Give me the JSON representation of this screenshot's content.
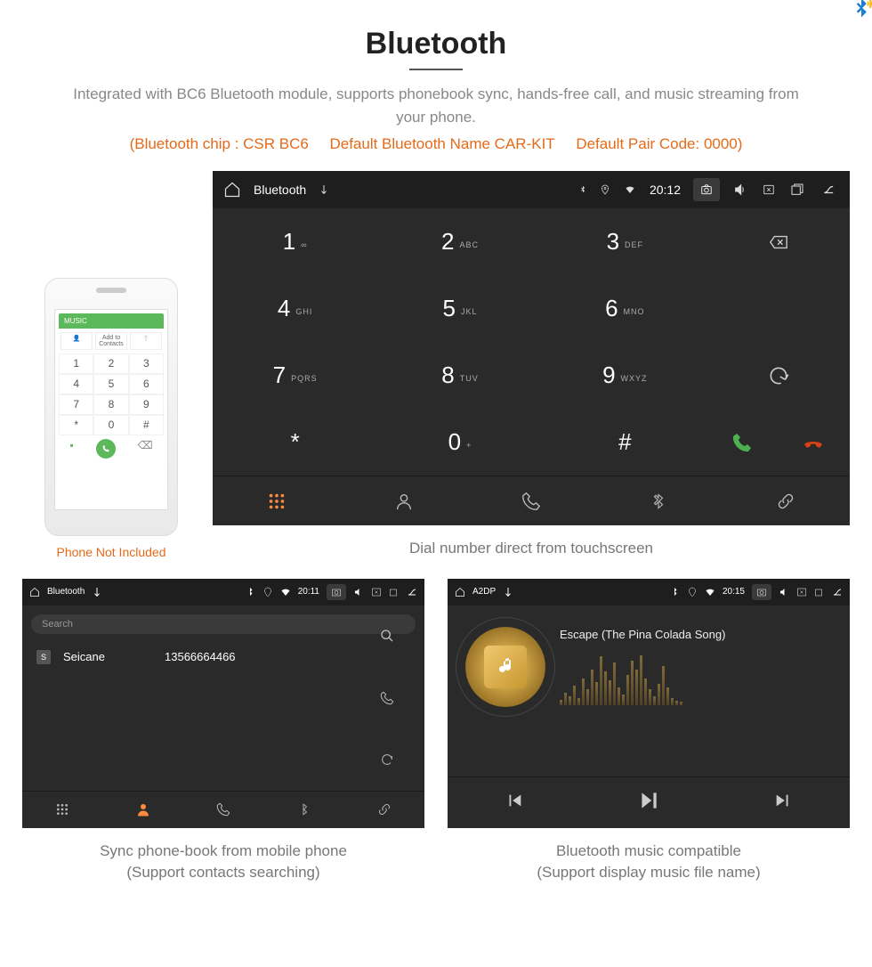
{
  "header": {
    "title": "Bluetooth"
  },
  "intro": "Integrated with BC6 Bluetooth module, supports phonebook sync, hands-free call, and music streaming from your phone.",
  "spec": {
    "chip": "(Bluetooth chip : CSR BC6",
    "name": "Default Bluetooth Name CAR-KIT",
    "code": "Default Pair Code: 0000)"
  },
  "phone": {
    "header": "MUSIC",
    "add_contacts": "Add to Contacts",
    "keys": [
      "1",
      "2",
      "3",
      "4",
      "5",
      "6",
      "7",
      "8",
      "9",
      "*",
      "0",
      "#"
    ],
    "caption": "Phone Not Included"
  },
  "dialer": {
    "statusbar": {
      "title": "Bluetooth",
      "time": "20:12"
    },
    "keys": [
      {
        "n": "1",
        "l": "∞"
      },
      {
        "n": "2",
        "l": "ABC"
      },
      {
        "n": "3",
        "l": "DEF"
      },
      {
        "n": "4",
        "l": "GHI"
      },
      {
        "n": "5",
        "l": "JKL"
      },
      {
        "n": "6",
        "l": "MNO"
      },
      {
        "n": "7",
        "l": "PQRS"
      },
      {
        "n": "8",
        "l": "TUV"
      },
      {
        "n": "9",
        "l": "WXYZ"
      },
      {
        "n": "*",
        "l": ""
      },
      {
        "n": "0",
        "l": "+"
      },
      {
        "n": "#",
        "l": ""
      }
    ],
    "caption": "Dial number direct from touchscreen"
  },
  "phonebook": {
    "statusbar": {
      "title": "Bluetooth",
      "time": "20:11"
    },
    "search_placeholder": "Search",
    "contact": {
      "initial": "S",
      "name": "Seicane",
      "number": "13566664466"
    },
    "caption": "Sync phone-book from mobile phone",
    "caption2": "(Support contacts searching)"
  },
  "music": {
    "statusbar": {
      "title": "A2DP",
      "time": "20:15"
    },
    "track": "Escape (The Pina Colada Song)",
    "viz": [
      6,
      14,
      10,
      22,
      8,
      30,
      18,
      40,
      26,
      55,
      38,
      28,
      48,
      20,
      12,
      34,
      50,
      40,
      56,
      30,
      18,
      10,
      24,
      44,
      20,
      8,
      5,
      4
    ],
    "caption": "Bluetooth music compatible",
    "caption2": "(Support display music file name)"
  }
}
